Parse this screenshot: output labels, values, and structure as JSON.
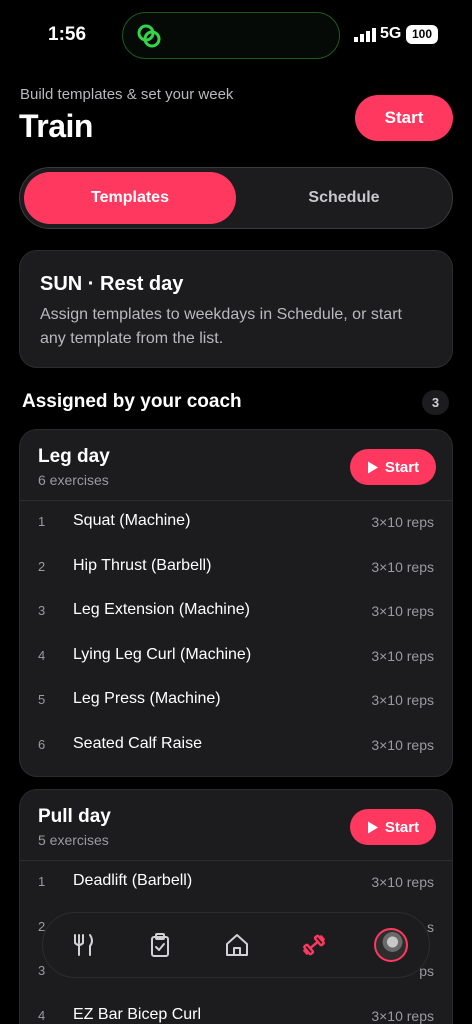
{
  "status_bar": {
    "time": "1:56",
    "network": "5G",
    "battery": "100"
  },
  "header": {
    "subtitle": "Build templates & set your week",
    "title": "Train",
    "start_label": "Start"
  },
  "segments": {
    "active": "Templates",
    "inactive": "Schedule"
  },
  "rest_card": {
    "title": "SUN · Rest day",
    "body": "Assign templates to weekdays in Schedule, or start any template from the list."
  },
  "section": {
    "title": "Assigned by your coach",
    "count": "3"
  },
  "templates": [
    {
      "name": "Leg day",
      "count": "6 exercises",
      "start_label": "Start",
      "exercises": [
        {
          "num": "1",
          "name": "Squat (Machine)",
          "reps": "3×10 reps"
        },
        {
          "num": "2",
          "name": "Hip Thrust (Barbell)",
          "reps": "3×10 reps"
        },
        {
          "num": "3",
          "name": "Leg Extension (Machine)",
          "reps": "3×10 reps"
        },
        {
          "num": "4",
          "name": "Lying Leg Curl (Machine)",
          "reps": "3×10 reps"
        },
        {
          "num": "5",
          "name": "Leg Press (Machine)",
          "reps": "3×10 reps"
        },
        {
          "num": "6",
          "name": "Seated Calf Raise",
          "reps": "3×10 reps"
        }
      ]
    },
    {
      "name": "Pull day",
      "count": "5 exercises",
      "start_label": "Start",
      "exercises": [
        {
          "num": "1",
          "name": "Deadlift (Barbell)",
          "reps": "3×10 reps"
        },
        {
          "num": "2",
          "name": "",
          "reps": "s"
        },
        {
          "num": "3",
          "name": "",
          "reps": "ps"
        },
        {
          "num": "4",
          "name": "EZ Bar Bicep Curl",
          "reps": "3×10 reps"
        }
      ]
    }
  ],
  "tab_bar": {
    "icons": [
      "fork-knife-icon",
      "clipboard-check-icon",
      "home-icon",
      "dumbbell-icon",
      "avatar"
    ],
    "active_color": "#ff3860"
  },
  "colors": {
    "accent": "#ff3860",
    "card": "#1c1c1e",
    "background": "#000000"
  }
}
